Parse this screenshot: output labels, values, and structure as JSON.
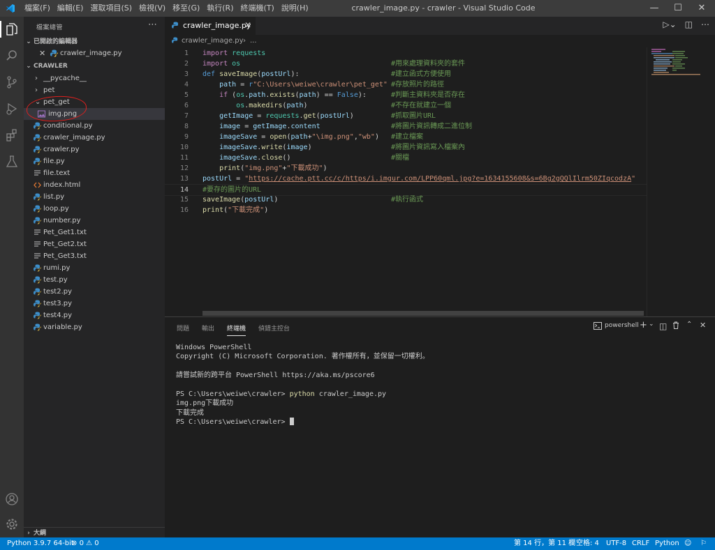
{
  "window": {
    "title": "crawler_image.py - crawler - Visual Studio Code",
    "menu": [
      "檔案(F)",
      "編輯(E)",
      "選取項目(S)",
      "檢視(V)",
      "移至(G)",
      "執行(R)",
      "終端機(T)",
      "說明(H)"
    ]
  },
  "activitybar": {
    "icons": [
      "explorer-icon",
      "search-icon",
      "source-control-icon",
      "run-debug-icon",
      "extensions-icon",
      "testing-icon",
      "account-icon",
      "settings-gear-icon"
    ]
  },
  "sidebar": {
    "title": "檔案總管",
    "open_editors_header": "已開啟的編輯器",
    "open_editor_file": "crawler_image.py",
    "folder_header": "CRAWLER",
    "tree": [
      {
        "label": "__pycache__",
        "kind": "folder",
        "expanded": false
      },
      {
        "label": "pet",
        "kind": "folder",
        "expanded": false
      },
      {
        "label": "pet_get",
        "kind": "folder",
        "expanded": true
      },
      {
        "label": "img.png",
        "kind": "image",
        "selected": true
      },
      {
        "label": "conditional.py",
        "kind": "py"
      },
      {
        "label": "crawler_image.py",
        "kind": "py"
      },
      {
        "label": "crawler.py",
        "kind": "py"
      },
      {
        "label": "file.py",
        "kind": "py"
      },
      {
        "label": "file.text",
        "kind": "txt"
      },
      {
        "label": "index.html",
        "kind": "html"
      },
      {
        "label": "list.py",
        "kind": "py"
      },
      {
        "label": "loop.py",
        "kind": "py"
      },
      {
        "label": "number.py",
        "kind": "py"
      },
      {
        "label": "Pet_Get1.txt",
        "kind": "txt"
      },
      {
        "label": "Pet_Get2.txt",
        "kind": "txt"
      },
      {
        "label": "Pet_Get3.txt",
        "kind": "txt"
      },
      {
        "label": "rumi.py",
        "kind": "py"
      },
      {
        "label": "test.py",
        "kind": "py"
      },
      {
        "label": "test2.py",
        "kind": "py"
      },
      {
        "label": "test3.py",
        "kind": "py"
      },
      {
        "label": "test4.py",
        "kind": "py"
      },
      {
        "label": "variable.py",
        "kind": "py"
      }
    ],
    "outline_header": "大綱"
  },
  "editor": {
    "tab_label": "crawler_image.py",
    "breadcrumb_file": "crawler_image.py",
    "breadcrumb_more": "...",
    "current_line": 14,
    "lines": [
      {
        "n": "1",
        "tokens": [
          [
            "k-ctl",
            "import"
          ],
          [
            "k-tx",
            " "
          ],
          [
            "k-mod",
            "requests"
          ]
        ],
        "comment": ""
      },
      {
        "n": "2",
        "tokens": [
          [
            "k-ctl",
            "import"
          ],
          [
            "k-tx",
            " "
          ],
          [
            "k-mod",
            "os"
          ]
        ],
        "comment": "#用來處理資料夾的套件"
      },
      {
        "n": "3",
        "tokens": [
          [
            "k-def",
            "def"
          ],
          [
            "k-tx",
            " "
          ],
          [
            "k-fn",
            "saveImage"
          ],
          [
            "k-tx",
            "("
          ],
          [
            "k-var",
            "postUrl"
          ],
          [
            "k-tx",
            "):"
          ]
        ],
        "comment": "#建立函式方便使用"
      },
      {
        "n": "4",
        "tokens": [
          [
            "k-tx",
            "    "
          ],
          [
            "k-var",
            "path"
          ],
          [
            "k-tx",
            " = "
          ],
          [
            "k-def",
            "r"
          ],
          [
            "k-str",
            "\"C:\\Users\\weiwe\\crawler\\pet_get\""
          ]
        ],
        "comment": "#存放照片的路徑"
      },
      {
        "n": "5",
        "tokens": [
          [
            "k-tx",
            "    "
          ],
          [
            "k-ctl",
            "if"
          ],
          [
            "k-tx",
            " ("
          ],
          [
            "k-mod",
            "os"
          ],
          [
            "k-tx",
            "."
          ],
          [
            "k-var",
            "path"
          ],
          [
            "k-tx",
            "."
          ],
          [
            "k-fn",
            "exists"
          ],
          [
            "k-tx",
            "("
          ],
          [
            "k-var",
            "path"
          ],
          [
            "k-tx",
            ") == "
          ],
          [
            "k-def",
            "False"
          ],
          [
            "k-tx",
            "):"
          ]
        ],
        "comment": "#判斷主資料夾是否存在"
      },
      {
        "n": "6",
        "tokens": [
          [
            "k-tx",
            "        "
          ],
          [
            "k-mod",
            "os"
          ],
          [
            "k-tx",
            "."
          ],
          [
            "k-fn",
            "makedirs"
          ],
          [
            "k-tx",
            "("
          ],
          [
            "k-var",
            "path"
          ],
          [
            "k-tx",
            ")"
          ]
        ],
        "comment": "#不存在就建立一個"
      },
      {
        "n": "7",
        "tokens": [
          [
            "k-tx",
            "    "
          ],
          [
            "k-var",
            "getImage"
          ],
          [
            "k-tx",
            " = "
          ],
          [
            "k-mod",
            "requests"
          ],
          [
            "k-tx",
            "."
          ],
          [
            "k-fn",
            "get"
          ],
          [
            "k-tx",
            "("
          ],
          [
            "k-var",
            "postUrl"
          ],
          [
            "k-tx",
            ")"
          ]
        ],
        "comment": "#抓取圖片URL"
      },
      {
        "n": "8",
        "tokens": [
          [
            "k-tx",
            "    "
          ],
          [
            "k-var",
            "image"
          ],
          [
            "k-tx",
            " = "
          ],
          [
            "k-var",
            "getImage"
          ],
          [
            "k-tx",
            "."
          ],
          [
            "k-var",
            "content"
          ]
        ],
        "comment": "#將圖片資訊轉成二進位制"
      },
      {
        "n": "9",
        "tokens": [
          [
            "k-tx",
            "    "
          ],
          [
            "k-var",
            "imageSave"
          ],
          [
            "k-tx",
            " = "
          ],
          [
            "k-fn",
            "open"
          ],
          [
            "k-tx",
            "("
          ],
          [
            "k-var",
            "path"
          ],
          [
            "k-tx",
            "+"
          ],
          [
            "k-str",
            "\"\\img.png\""
          ],
          [
            "k-tx",
            ","
          ],
          [
            "k-str",
            "\"wb\""
          ],
          [
            "k-tx",
            ")"
          ]
        ],
        "comment": "#建立檔案"
      },
      {
        "n": "10",
        "tokens": [
          [
            "k-tx",
            "    "
          ],
          [
            "k-var",
            "imageSave"
          ],
          [
            "k-tx",
            "."
          ],
          [
            "k-fn",
            "write"
          ],
          [
            "k-tx",
            "("
          ],
          [
            "k-var",
            "image"
          ],
          [
            "k-tx",
            ")"
          ]
        ],
        "comment": "#將圖片資訊寫入檔案內"
      },
      {
        "n": "11",
        "tokens": [
          [
            "k-tx",
            "    "
          ],
          [
            "k-var",
            "imageSave"
          ],
          [
            "k-tx",
            "."
          ],
          [
            "k-fn",
            "close"
          ],
          [
            "k-tx",
            "()"
          ]
        ],
        "comment": "#關檔"
      },
      {
        "n": "12",
        "tokens": [
          [
            "k-tx",
            "    "
          ],
          [
            "k-fn",
            "print"
          ],
          [
            "k-tx",
            "("
          ],
          [
            "k-str",
            "\"img.png\""
          ],
          [
            "k-tx",
            "+"
          ],
          [
            "k-str",
            "\"下載成功\""
          ],
          [
            "k-tx",
            ")"
          ]
        ],
        "comment": ""
      },
      {
        "n": "13",
        "tokens": [
          [
            "k-var",
            "postUrl"
          ],
          [
            "k-tx",
            " = "
          ],
          [
            "k-str",
            "\""
          ],
          [
            "k-link",
            "https://cache.ptt.cc/c/https/i.imgur.com/LPP60qml.jpg?e=1634155608&s=6Bg2gQQlIlrm50ZIqcodzA"
          ],
          [
            "k-str",
            "\""
          ]
        ],
        "comment": ""
      },
      {
        "n": "14",
        "tokens": [
          [
            "k-cmt",
            "#要存的圖片的URL"
          ]
        ],
        "comment": ""
      },
      {
        "n": "15",
        "tokens": [
          [
            "k-fn",
            "saveImage"
          ],
          [
            "k-tx",
            "("
          ],
          [
            "k-var",
            "postUrl"
          ],
          [
            "k-tx",
            ")"
          ]
        ],
        "comment": "#執行函式"
      },
      {
        "n": "16",
        "tokens": [
          [
            "k-fn",
            "print"
          ],
          [
            "k-tx",
            "("
          ],
          [
            "k-str",
            "\"下載完成\""
          ],
          [
            "k-tx",
            ")"
          ]
        ],
        "comment": ""
      }
    ]
  },
  "panel": {
    "tabs": [
      "問題",
      "輸出",
      "終端機",
      "偵錯主控台"
    ],
    "active_tab": "終端機",
    "shell_label": "powershell",
    "terminal_lines": [
      {
        "type": "plain",
        "text": "Windows PowerShell"
      },
      {
        "type": "plain",
        "text": "Copyright (C) Microsoft Corporation. 著作權所有，並保留一切權利。"
      },
      {
        "type": "plain",
        "text": ""
      },
      {
        "type": "plain",
        "text": "請嘗試新的跨平台 PowerShell https://aka.ms/pscore6"
      },
      {
        "type": "plain",
        "text": ""
      },
      {
        "type": "cmd",
        "prompt": "PS C:\\Users\\weiwe\\crawler> ",
        "cmd": "python",
        "args": " crawler_image.py"
      },
      {
        "type": "plain",
        "text": "img.png下載成功"
      },
      {
        "type": "plain",
        "text": "下載完成"
      },
      {
        "type": "prompt",
        "prompt": "PS C:\\Users\\weiwe\\crawler> "
      }
    ]
  },
  "statusbar": {
    "python": "Python 3.9.7 64-bit",
    "errors": "0",
    "warnings": "0",
    "position": "第 14 行，第 11 欄",
    "spaces": "空格: 4",
    "encoding": "UTF-8",
    "eol": "CRLF",
    "language": "Python"
  },
  "colors": {
    "accent": "#007acc",
    "annotation_circle": "#e0201e"
  }
}
